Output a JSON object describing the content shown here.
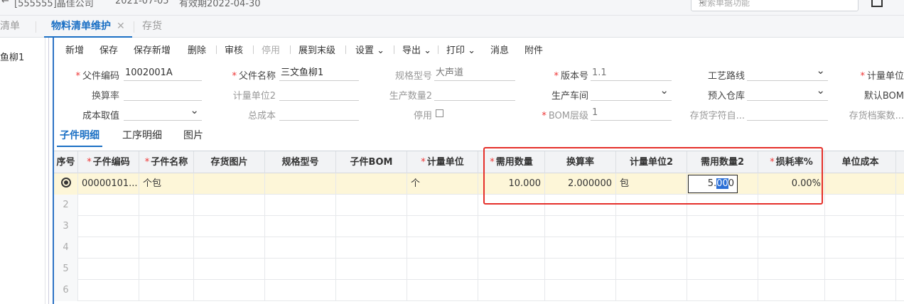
{
  "topbar": {
    "org": "[555555]晶佳公司",
    "date": "2021-07-05",
    "valid": "有效期2022-04-30",
    "search_placeholder": "搜索单据功能"
  },
  "tabs": [
    {
      "label": "清单"
    },
    {
      "label": "物料清单维护",
      "close": "✕"
    },
    {
      "label": "存货"
    }
  ],
  "left_pane": {
    "item": "鱼柳1"
  },
  "toolbar": {
    "new": "新增",
    "save": "保存",
    "save_new": "保存新增",
    "delete": "删除",
    "audit": "审核",
    "disable": "停用",
    "expand": "展到末级",
    "settings": "设置",
    "export": "导出",
    "print": "打印",
    "message": "消息",
    "attachment": "附件"
  },
  "form": {
    "parent_code_label": "父件编码",
    "parent_code": "1002001A",
    "parent_name_label": "父件名称",
    "parent_name": "三文鱼柳1",
    "spec_label": "规格型号",
    "spec": "大声道",
    "version_label": "版本号",
    "version": "1.1",
    "route_label": "工艺路线",
    "route": "",
    "unit_label": "计量单位",
    "rate_label": "换算率",
    "rate": "",
    "unit2_label": "计量单位2",
    "unit2": "",
    "qty2_label": "生产数量2",
    "qty2": "",
    "workshop_label": "生产车间",
    "workshop": "",
    "warehouse_label": "预入仓库",
    "warehouse": "",
    "default_bom_label": "默认BOM",
    "cost_label": "成本取值",
    "cost": "",
    "total_cost_label": "总成本",
    "total_cost": "",
    "disable_label": "停用",
    "bom_level_label": "BOM层级",
    "bom_level": "1",
    "inv_char_label": "存货字符自...",
    "inv_char": "",
    "inv_file_label": "存货档案数..."
  },
  "subtabs": [
    "子件明细",
    "工序明细",
    "图片"
  ],
  "grid": {
    "headers": {
      "idx": "序号",
      "code": "子件编码",
      "name": "子件名称",
      "img": "存货图片",
      "spec": "规格型号",
      "bom": "子件BOM",
      "unit": "计量单位",
      "qty": "需用数量",
      "rate": "换算率",
      "unit2": "计量单位2",
      "qty2": "需用数量2",
      "loss": "损耗率%",
      "unitcost": "单位成本"
    },
    "row1": {
      "code": "00000101...",
      "name": "个包",
      "unit": "个",
      "qty": "10.000",
      "rate": "2.000000",
      "unit2": "包",
      "qty2_pre": "5.",
      "qty2_sel": "00",
      "qty2_post": "0",
      "loss": "0.00%"
    },
    "empty_rows": [
      "2",
      "3",
      "4",
      "5",
      "6"
    ]
  },
  "colors": {
    "accent": "#1a6fc4",
    "required": "#e33333",
    "highlight_box": "#e5302a",
    "active_row": "#fdf6d8"
  }
}
